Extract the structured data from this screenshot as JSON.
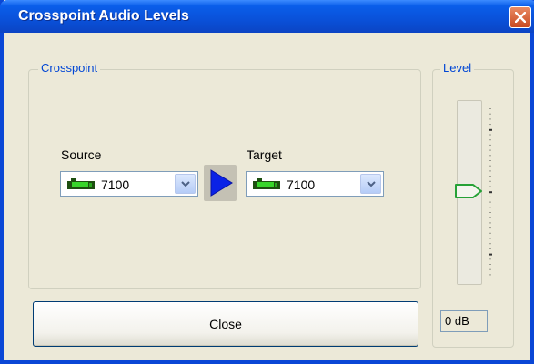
{
  "window": {
    "title": "Crosspoint Audio Levels",
    "titlebar_color": "#0a51d9",
    "close_button_color": "#c94a22"
  },
  "crosspoint": {
    "group_label": "Crosspoint",
    "source": {
      "label": "Source",
      "value": "7100",
      "icon": "green-device-icon"
    },
    "route_arrow_icon": "play-arrow-icon",
    "target": {
      "label": "Target",
      "value": "7100",
      "icon": "green-device-icon"
    }
  },
  "level": {
    "group_label": "Level",
    "slider_fraction": 0.5,
    "readout": "0 dB"
  },
  "footer": {
    "close_label": "Close"
  }
}
